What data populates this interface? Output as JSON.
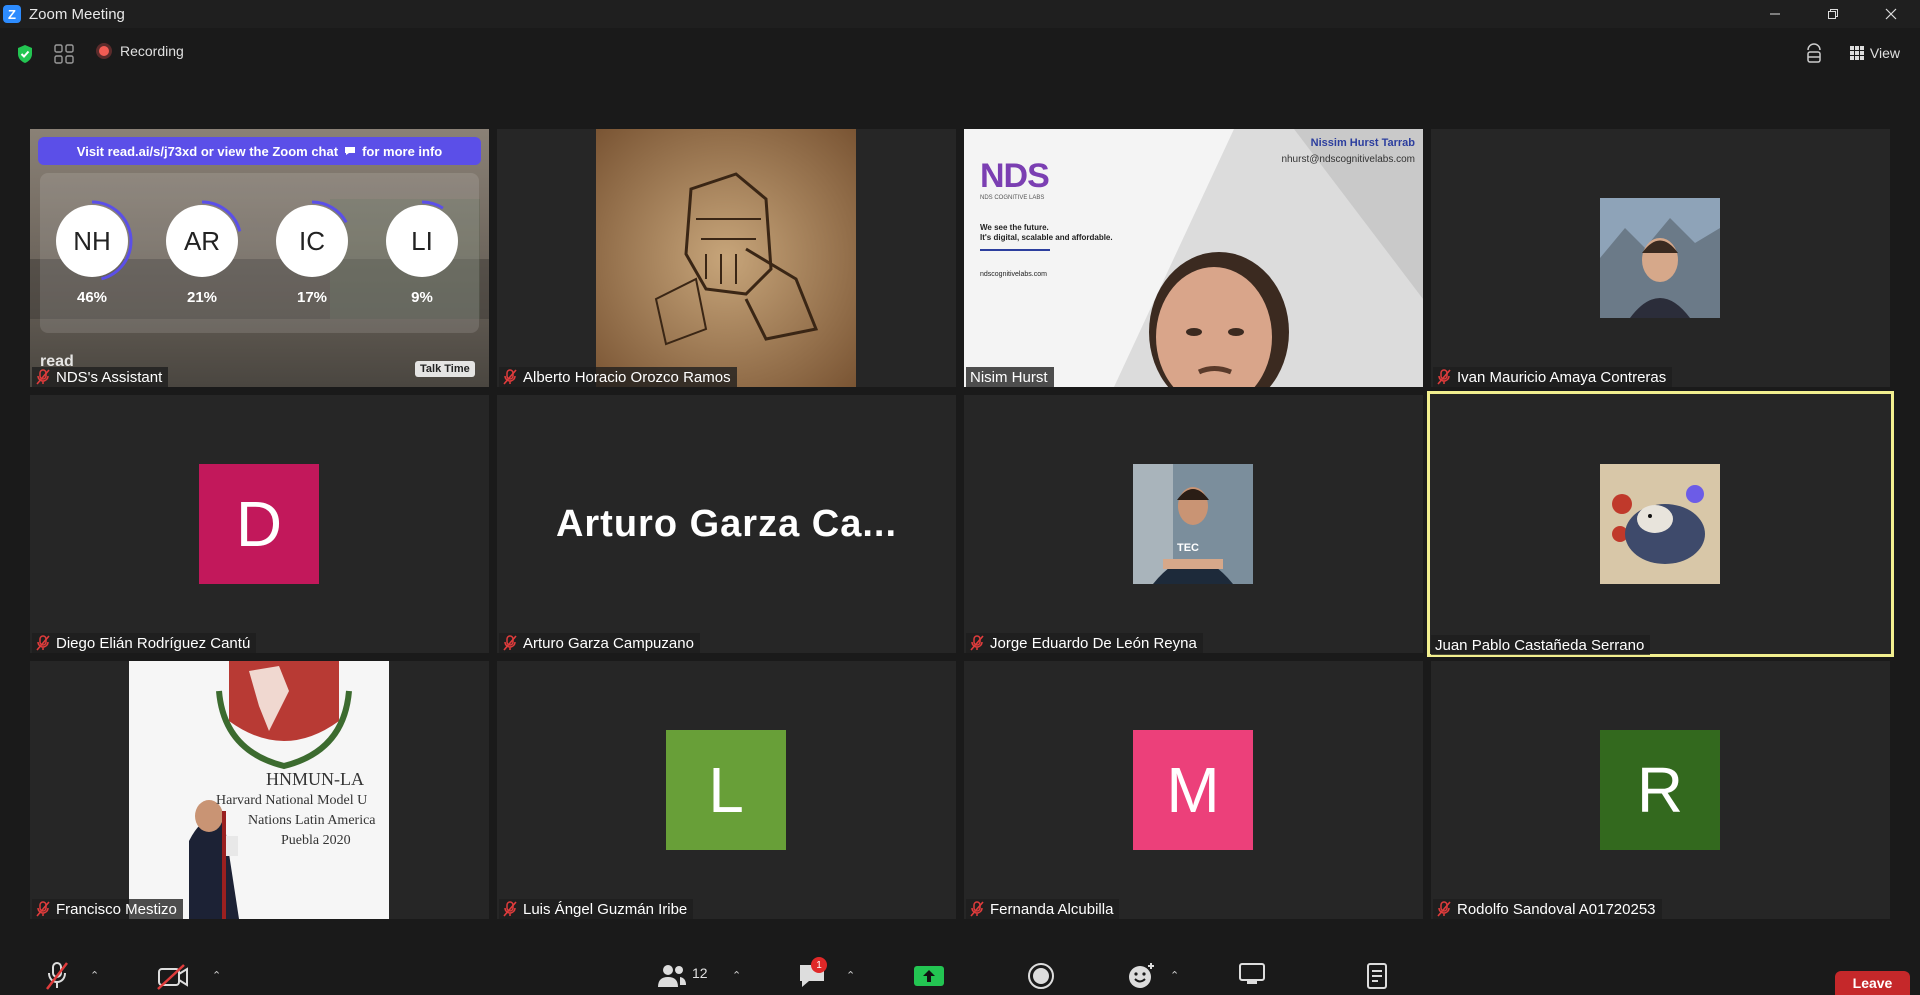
{
  "window": {
    "title": "Zoom Meeting",
    "logo_letter": "Z"
  },
  "top_bar": {
    "recording_label": "Recording",
    "view_label": "View"
  },
  "readai": {
    "banner_text": "Visit read.ai/s/j73xd or view the Zoom chat",
    "banner_suffix": "for more info",
    "talk_time_label": "Talk Time",
    "brand": "read",
    "speakers": [
      {
        "initials": "NH",
        "percent": "46%",
        "share": 0.46
      },
      {
        "initials": "AR",
        "percent": "21%",
        "share": 0.21
      },
      {
        "initials": "IC",
        "percent": "17%",
        "share": 0.17
      },
      {
        "initials": "LI",
        "percent": "9%",
        "share": 0.09
      }
    ]
  },
  "share_slide": {
    "presenter_name": "Nissim Hurst Tarrab",
    "email": "nhurst@ndscognitivelabs.com",
    "logo_text": "NDS",
    "logo_sub": "NDS COGNITIVE LABS",
    "tagline_1": "We see the future.",
    "tagline_2": "It's digital, scalable and affordable.",
    "website": "ndscognitivelabs.com"
  },
  "certificate": {
    "line_1": "HNMUN-LA",
    "line_2": "Harvard National Model U",
    "line_3": "Nations Latin America",
    "line_4": "Puebla 2020"
  },
  "tee_text": "TEC",
  "participants": [
    {
      "name": "NDS's Assistant",
      "muted": true
    },
    {
      "name": "Alberto Horacio Orozco Ramos",
      "muted": true
    },
    {
      "name": "Nisim Hurst",
      "muted": false
    },
    {
      "name": "Ivan Mauricio Amaya Contreras",
      "muted": true
    },
    {
      "name": "Diego Elián Rodríguez Cantú",
      "muted": true,
      "avatar_letter": "D",
      "avatar_color": "#c2185b"
    },
    {
      "name": "Arturo Garza Campuzano",
      "muted": true,
      "display_text": "Arturo Garza Ca..."
    },
    {
      "name": "Jorge Eduardo De León Reyna",
      "muted": true
    },
    {
      "name": "Juan Pablo Castañeda Serrano",
      "muted": false
    },
    {
      "name": "Francisco Mestizo",
      "muted": true
    },
    {
      "name": "Luis Ángel Guzmán Iribe",
      "muted": true,
      "avatar_letter": "L",
      "avatar_color": "#689f38"
    },
    {
      "name": "Fernanda Alcubilla",
      "muted": true,
      "avatar_letter": "M",
      "avatar_color": "#ec407a"
    },
    {
      "name": "Rodolfo Sandoval A01720253",
      "muted": true,
      "avatar_letter": "R",
      "avatar_color": "#33691e"
    }
  ],
  "bottom_bar": {
    "participants_count": "12",
    "chat_badge": "1",
    "leave_label": "Leave"
  },
  "colors": {
    "accent": "#2d8cff",
    "active_speaker": "#f2ef8f",
    "leave": "#c5282a",
    "share": "#23c552"
  }
}
